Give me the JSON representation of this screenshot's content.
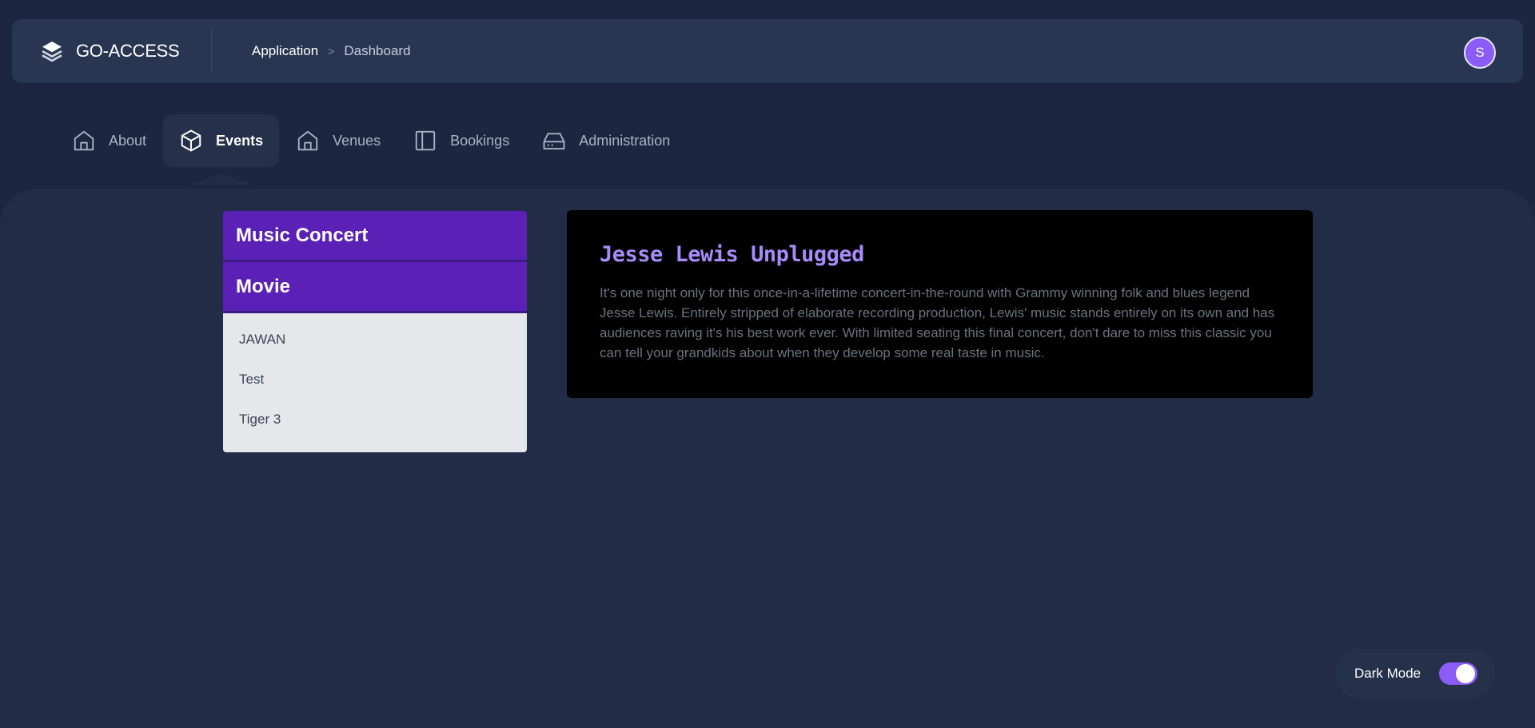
{
  "header": {
    "brand": "GO-ACCESS",
    "breadcrumb": {
      "application": "Application",
      "separator": ">",
      "dashboard": "Dashboard"
    },
    "avatar_initial": "S"
  },
  "nav": {
    "items": [
      {
        "label": "About",
        "icon": "home-icon"
      },
      {
        "label": "Events",
        "icon": "cube-icon",
        "active": true
      },
      {
        "label": "Venues",
        "icon": "home-icon"
      },
      {
        "label": "Bookings",
        "icon": "panel-icon"
      },
      {
        "label": "Administration",
        "icon": "drive-icon"
      }
    ]
  },
  "sidebar": {
    "categories": [
      {
        "title": "Music Concert"
      },
      {
        "title": "Movie",
        "items": [
          "JAWAN",
          "Test",
          "Tiger 3"
        ]
      }
    ]
  },
  "detail": {
    "title": "Jesse Lewis Unplugged",
    "description": "It's one night only for this once-in-a-lifetime concert-in-the-round with Grammy winning folk and blues legend Jesse Lewis. Entirely stripped of elaborate recording production, Lewis' music stands entirely on its own and has audiences raving it's his best work ever. With limited seating this final concert, don't dare to miss this classic you can tell your grandkids about when they develop some real taste in music."
  },
  "dark_mode": {
    "label": "Dark Mode",
    "enabled": true
  },
  "colors": {
    "accent": "#8b5cf6",
    "category_header": "#5b21b6",
    "title": "#a78bfa",
    "background": "#1c2640"
  }
}
